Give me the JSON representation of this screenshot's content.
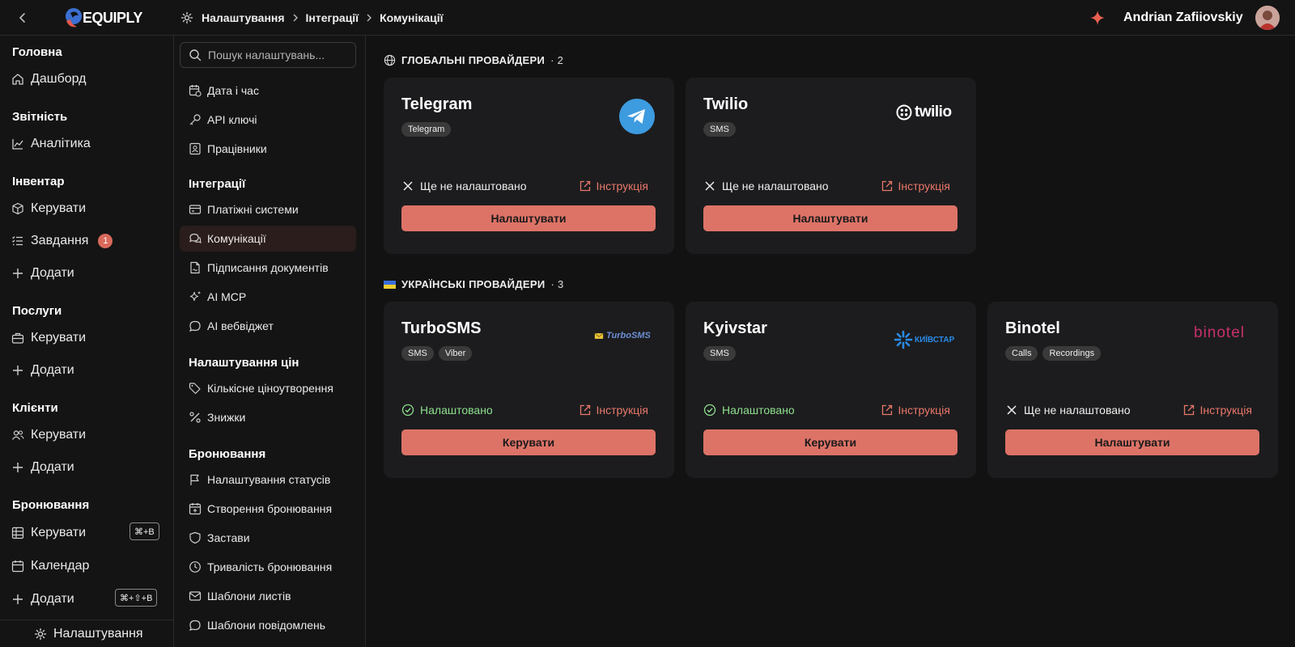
{
  "app": {
    "brand": "EQUIPLY",
    "user_name": "Andrian Zafiiovskiy"
  },
  "breadcrumb": [
    "Налаштування",
    "Інтеграції",
    "Комунікації"
  ],
  "sidebar": {
    "groups": [
      {
        "title": "Головна",
        "items": [
          {
            "label": "Дашборд",
            "icon": "home-icon"
          }
        ]
      },
      {
        "title": "Звітність",
        "items": [
          {
            "label": "Аналітика",
            "icon": "chart-icon"
          }
        ]
      },
      {
        "title": "Інвентар",
        "items": [
          {
            "label": "Керувати",
            "icon": "box-icon"
          },
          {
            "label": "Завдання",
            "icon": "tasks-icon",
            "badge": "1"
          },
          {
            "label": "Додати",
            "icon": "plus-icon"
          }
        ]
      },
      {
        "title": "Послуги",
        "items": [
          {
            "label": "Керувати",
            "icon": "briefcase-icon"
          },
          {
            "label": "Додати",
            "icon": "plus-icon"
          }
        ]
      },
      {
        "title": "Клієнти",
        "items": [
          {
            "label": "Керувати",
            "icon": "users-icon"
          },
          {
            "label": "Додати",
            "icon": "plus-icon"
          }
        ]
      },
      {
        "title": "Бронювання",
        "items": [
          {
            "label": "Керувати",
            "icon": "grid-icon",
            "shortcut": "⌘+B"
          },
          {
            "label": "Календар",
            "icon": "calendar-icon"
          },
          {
            "label": "Додати",
            "icon": "plus-icon",
            "shortcut": "⌘+⇧+B"
          }
        ]
      }
    ],
    "footer_label": "Налаштування"
  },
  "settings_nav": {
    "search_placeholder": "Пошук налаштувань...",
    "top_items": [
      "Дата і час",
      "API ключі",
      "Працівники"
    ],
    "groups": [
      {
        "title": "Інтеграції",
        "items": [
          "Платіжні системи",
          "Комунікації",
          "Підписання документів",
          "AI MCP",
          "AI вебвіджет"
        ]
      },
      {
        "title": "Налаштування цін",
        "items": [
          "Кількісне ціноутворення",
          "Знижки"
        ]
      },
      {
        "title": "Бронювання",
        "items": [
          "Налаштування статусів",
          "Створення бронювання",
          "Застави",
          "Тривалість бронювання",
          "Шаблони листів",
          "Шаблони повідомлень"
        ]
      }
    ],
    "active_item": "Комунікації"
  },
  "sections": [
    {
      "title": "ГЛОБАЛЬНІ ПРОВАЙДЕРИ",
      "count": "· 2",
      "icon": "globe-icon",
      "cards": [
        {
          "name": "Telegram",
          "tags": [
            "Telegram"
          ],
          "status": "Ще не налаштовано",
          "configured": false,
          "guide": "Інструкція",
          "action": "Налаштувати",
          "logo": "telegram-logo"
        },
        {
          "name": "Twilio",
          "tags": [
            "SMS"
          ],
          "status": "Ще не налаштовано",
          "configured": false,
          "guide": "Інструкція",
          "action": "Налаштувати",
          "logo": "twilio-logo",
          "logo_text": "twilio"
        }
      ]
    },
    {
      "title": "УКРАЇНСЬКІ ПРОВАЙДЕРИ",
      "count": "· 3",
      "icon": "ukraine-flag-icon",
      "cards": [
        {
          "name": "TurboSMS",
          "tags": [
            "SMS",
            "Viber"
          ],
          "status": "Налаштовано",
          "configured": true,
          "guide": "Інструкція",
          "action": "Керувати",
          "logo": "turbosms-logo",
          "logo_text": "TurboSMS"
        },
        {
          "name": "Kyivstar",
          "tags": [
            "SMS"
          ],
          "status": "Налаштовано",
          "configured": true,
          "guide": "Інструкція",
          "action": "Керувати",
          "logo": "kyivstar-logo",
          "logo_text": "КИЇВСТАР"
        },
        {
          "name": "Binotel",
          "tags": [
            "Calls",
            "Recordings"
          ],
          "status": "Ще не налаштовано",
          "configured": false,
          "guide": "Інструкція",
          "action": "Налаштувати",
          "logo": "binotel-logo",
          "logo_text": "binotel"
        }
      ]
    }
  ],
  "colors": {
    "accent": "#dd7367",
    "background": "#121212",
    "card": "#1c1c1e",
    "success": "#8ee08e"
  }
}
